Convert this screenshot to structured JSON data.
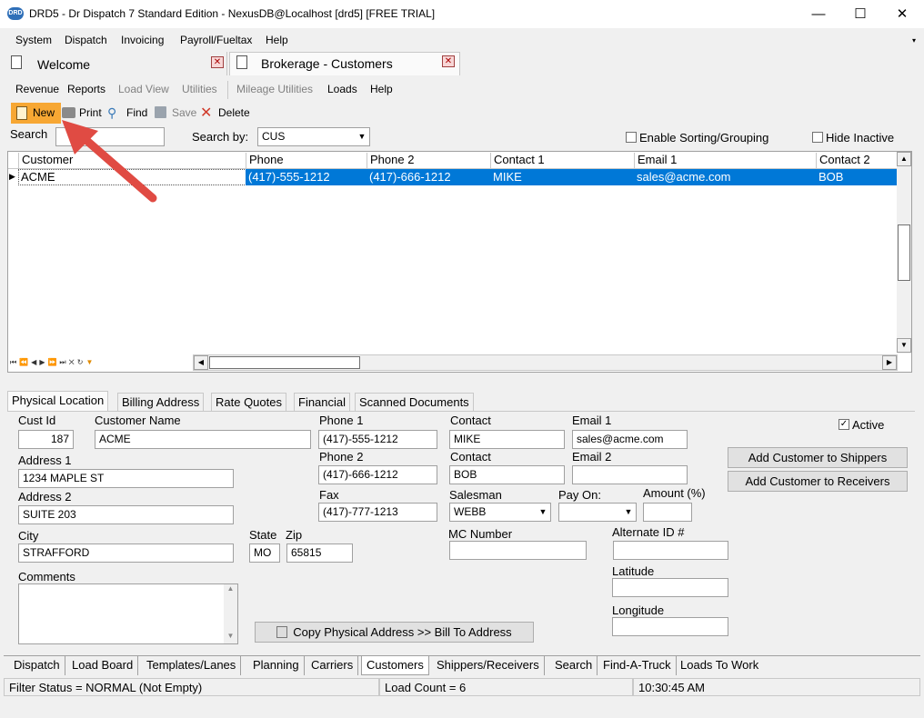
{
  "window": {
    "title": "DRD5 - Dr Dispatch 7 Standard Edition - NexusDB@Localhost [drd5] [FREE TRIAL]",
    "app_icon": "DRD",
    "minimize": "—",
    "maximize": "☐",
    "close": "✕"
  },
  "menu": [
    "System",
    "Dispatch",
    "Invoicing",
    "Payroll/Fueltax",
    "Help"
  ],
  "doc_tabs": [
    {
      "label": "Welcome"
    },
    {
      "label": "Brokerage - Customers"
    }
  ],
  "submenu": [
    "Revenue",
    "Reports",
    "Load View",
    "Utilities",
    "Mileage Utilities",
    "Loads",
    "Help"
  ],
  "toolbar": {
    "new": "New",
    "print": "Print",
    "find": "Find",
    "save": "Save",
    "delete": "Delete"
  },
  "search": {
    "label": "Search",
    "value": "",
    "search_by_label": "Search by:",
    "search_by_value": "CUS",
    "enable_sorting": "Enable Sorting/Grouping",
    "hide_inactive": "Hide Inactive"
  },
  "grid": {
    "columns": [
      "Customer",
      "Phone",
      "Phone 2",
      "Contact 1",
      "Email 1",
      "Contact 2"
    ],
    "rows": [
      [
        "ACME",
        "(417)-555-1212",
        "(417)-666-1212",
        "MIKE",
        "sales@acme.com",
        "BOB"
      ]
    ]
  },
  "detail_tabs": [
    "Physical Location",
    "Billing Address",
    "Rate Quotes",
    "Financial",
    "Scanned Documents"
  ],
  "form": {
    "cust_id_label": "Cust Id",
    "cust_id": "187",
    "customer_name_label": "Customer Name",
    "customer_name": "ACME",
    "address1_label": "Address 1",
    "address1": "1234 MAPLE ST",
    "address2_label": "Address 2",
    "address2": "SUITE 203",
    "city_label": "City",
    "city": "STRAFFORD",
    "state_label": "State",
    "state": "MO",
    "zip_label": "Zip",
    "zip": "65815",
    "comments_label": "Comments",
    "comments": "",
    "phone1_label": "Phone 1",
    "phone1": "(417)-555-1212",
    "phone2_label": "Phone 2",
    "phone2": "(417)-666-1212",
    "fax_label": "Fax",
    "fax": "(417)-777-1213",
    "contact1_label": "Contact",
    "contact1": "MIKE",
    "contact2_label": "Contact",
    "contact2": "BOB",
    "email1_label": "Email 1",
    "email1": "sales@acme.com",
    "email2_label": "Email 2",
    "email2": "",
    "salesman_label": "Salesman",
    "salesman": "WEBB",
    "pay_on_label": "Pay On:",
    "pay_on": "",
    "amount_label": "Amount (%)",
    "amount": "",
    "mc_label": "MC Number",
    "mc": "",
    "alt_id_label": "Alternate ID #",
    "alt_id": "",
    "lat_label": "Latitude",
    "lat": "",
    "lon_label": "Longitude",
    "lon": "",
    "active_label": "Active",
    "active_check": "✓",
    "add_shippers": "Add Customer to Shippers",
    "add_receivers": "Add Customer to Receivers",
    "copy_address": "Copy Physical Address >> Bill To Address"
  },
  "bottom_tabs": [
    "Dispatch",
    "Load Board",
    "Templates/Lanes",
    "Planning",
    "Carriers",
    "Customers",
    "Shippers/Receivers",
    "Search",
    "Find-A-Truck",
    "Loads To Work"
  ],
  "status": {
    "filter": "Filter Status = NORMAL (Not Empty)",
    "load_count": "Load Count = 6",
    "time": "10:30:45 AM"
  },
  "colors": {
    "selection": "#0078d7",
    "new_highlight": "#f7a733",
    "arrow": "#e04b43"
  }
}
